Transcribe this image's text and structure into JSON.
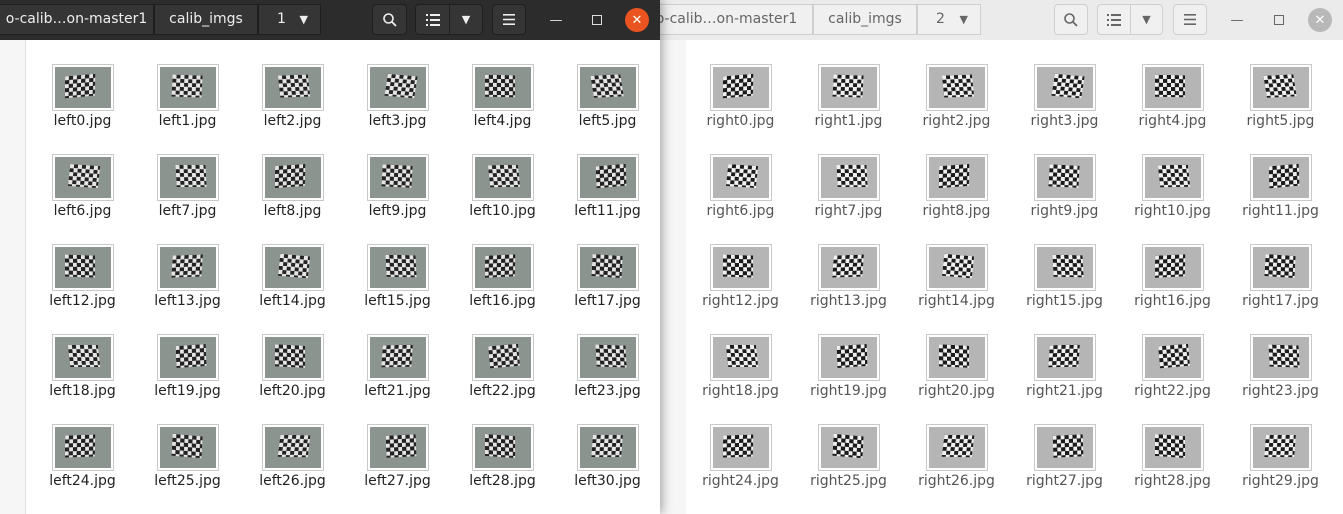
{
  "left_window": {
    "path_segments": [
      "o-calib…on-master1",
      "calib_imgs",
      "1"
    ],
    "files": [
      "left0.jpg",
      "left1.jpg",
      "left2.jpg",
      "left3.jpg",
      "left4.jpg",
      "left5.jpg",
      "left6.jpg",
      "left7.jpg",
      "left8.jpg",
      "left9.jpg",
      "left10.jpg",
      "left11.jpg",
      "left12.jpg",
      "left13.jpg",
      "left14.jpg",
      "left15.jpg",
      "left16.jpg",
      "left17.jpg",
      "left18.jpg",
      "left19.jpg",
      "left20.jpg",
      "left21.jpg",
      "left22.jpg",
      "left23.jpg",
      "left24.jpg",
      "left25.jpg",
      "left26.jpg",
      "left27.jpg",
      "left28.jpg",
      "left30.jpg"
    ]
  },
  "right_window": {
    "path_segments": [
      "o-calib…on-master1",
      "calib_imgs",
      "2"
    ],
    "files": [
      "right0.jpg",
      "right1.jpg",
      "right2.jpg",
      "right3.jpg",
      "right4.jpg",
      "right5.jpg",
      "right6.jpg",
      "right7.jpg",
      "right8.jpg",
      "right9.jpg",
      "right10.jpg",
      "right11.jpg",
      "right12.jpg",
      "right13.jpg",
      "right14.jpg",
      "right15.jpg",
      "right16.jpg",
      "right17.jpg",
      "right18.jpg",
      "right19.jpg",
      "right20.jpg",
      "right21.jpg",
      "right22.jpg",
      "right23.jpg",
      "right24.jpg",
      "right25.jpg",
      "right26.jpg",
      "right27.jpg",
      "right28.jpg",
      "right29.jpg"
    ]
  },
  "icons": {
    "dropdown": "chevron-down-icon",
    "search": "search-icon",
    "list_view": "list-view-icon",
    "menu": "hamburger-menu-icon",
    "minimize": "minimize-icon",
    "maximize": "maximize-icon",
    "close": "close-icon"
  },
  "colors": {
    "headerbar_dark": "#2c2c2c",
    "headerbar_light": "#ebebeb",
    "close_button": "#e95420"
  }
}
